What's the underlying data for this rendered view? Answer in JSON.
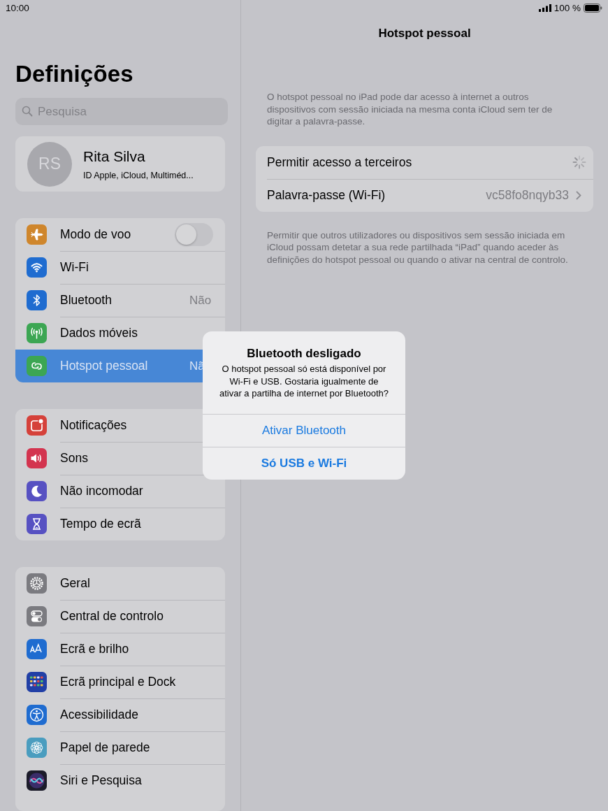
{
  "status_bar": {
    "time": "10:00",
    "battery": "100 %"
  },
  "sidebar": {
    "title": "Definições",
    "search": {
      "placeholder": "Pesquisa"
    },
    "profile": {
      "initials": "RS",
      "name": "Rita Silva",
      "subtitle": "ID Apple, iCloud, Multiméd..."
    },
    "groups": [
      {
        "items": [
          {
            "label": "Modo de voo",
            "kind": "airplane",
            "on": false,
            "selected": false
          },
          {
            "label": "Wi-Fi",
            "kind": "wifi",
            "selected": false
          },
          {
            "label": "Bluetooth",
            "kind": "bluetooth",
            "value": "Não",
            "selected": false
          },
          {
            "label": "Dados móveis",
            "kind": "antenna",
            "selected": false
          },
          {
            "label": "Hotspot pessoal",
            "kind": "hotspot",
            "value": "Nã",
            "selected": true
          }
        ]
      },
      {
        "items": [
          {
            "label": "Notificações",
            "kind": "notifications",
            "selected": false
          },
          {
            "label": "Sons",
            "kind": "sounds",
            "selected": false
          },
          {
            "label": "Não incomodar",
            "kind": "moon",
            "selected": false
          },
          {
            "label": "Tempo de ecrã",
            "kind": "hourglass",
            "selected": false
          }
        ]
      },
      {
        "items": [
          {
            "label": "Geral",
            "kind": "gear",
            "selected": false
          },
          {
            "label": "Central de controlo",
            "kind": "switches",
            "selected": false
          },
          {
            "label": "Ecrã e brilho",
            "kind": "textsize",
            "selected": false
          },
          {
            "label": "Ecrã principal e Dock",
            "kind": "grid",
            "selected": false
          },
          {
            "label": "Acessibilidade",
            "kind": "accessibility",
            "selected": false
          },
          {
            "label": "Papel de parede",
            "kind": "flower",
            "selected": false
          },
          {
            "label": "Siri e Pesquisa",
            "kind": "siri",
            "selected": false
          }
        ]
      }
    ]
  },
  "detail": {
    "title": "Hotspot pessoal",
    "description": "O hotspot pessoal no iPad pode dar acesso à internet a outros dispositivos com sessão iniciada na mesma conta iCloud sem ter de digitar a palavra-passe.",
    "rows": [
      {
        "label": "Permitir acesso a terceiros",
        "kind": "spinner"
      },
      {
        "label": "Palavra-passe (Wi-Fi)",
        "kind": "link",
        "value": "vc58fo8nqyb33"
      }
    ],
    "footer": "Permitir que outros utilizadores ou dispositivos sem sessão iniciada em iCloud possam detetar a sua rede partilhada “iPad” quando aceder às definições do hotspot pessoal ou quando o ativar na central de controlo."
  },
  "alert": {
    "title": "Bluetooth desligado",
    "message": "O hotspot pessoal só está disponível por Wi-Fi e USB. Gostaria igualmente de ativar a partilha de internet por Bluetooth?",
    "buttons": [
      {
        "label": "Ativar Bluetooth",
        "kind": "default"
      },
      {
        "label": "Só USB e Wi-Fi",
        "kind": "preferred"
      }
    ]
  }
}
